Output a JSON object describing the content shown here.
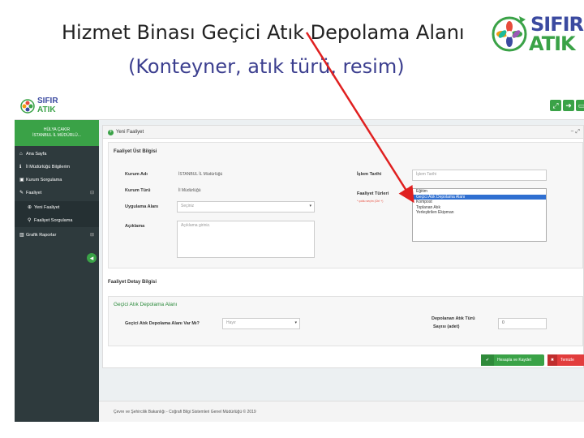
{
  "slide": {
    "title": "Hizmet Binası Geçici Atık Depolama Alanı",
    "subtitle": "(Konteyner, atık türü, resim)",
    "brand_top": "SIFIR",
    "brand_bottom": "ATIK"
  },
  "app": {
    "logo_top": "SIFIR",
    "logo_bottom": "ATIK",
    "topbar_buttons": [
      "⤢",
      "➜",
      "▭"
    ],
    "user_name": "HÜLYA ÇAKIR",
    "user_org": "İSTANBUL İL MÜDÜRLÜ...",
    "sidebar": {
      "items": [
        {
          "icon": "⌂",
          "label": "Ana Sayfa"
        },
        {
          "icon": "ℹ",
          "label": "İl Müdürlüğü Bilgilerim"
        },
        {
          "icon": "▣",
          "label": "Kurum Sorgulama"
        },
        {
          "icon": "✎",
          "label": "Faaliyet",
          "caret": "⊟"
        },
        {
          "icon": "⊕",
          "label": "Yeni Faaliyet"
        },
        {
          "icon": "⚲",
          "label": "Faaliyet Sorgulama"
        },
        {
          "icon": "▥",
          "label": "Grafik Raporlar",
          "caret": "⊞"
        }
      ],
      "collapse": "◂"
    },
    "panel": {
      "header": "Yeni Faaliyet",
      "tools": "−  ⤢",
      "ust_bilgi_title": "Faaliyet Üst Bilgisi",
      "kurum_adi_label": "Kurum Adı",
      "kurum_adi_value": "İSTANBUL İL Müdürlüğü",
      "kurum_turu_label": "Kurum Türü",
      "kurum_turu_value": "İl Müdürlüğü",
      "uygulama_alani_label": "Uygulama Alanı",
      "uygulama_alani_value": "Seçiniz",
      "aciklama_label": "Açıklama",
      "aciklama_placeholder": "Açıklama giriniz.",
      "islem_tarihi_label": "İşlem Tarihi",
      "islem_tarihi_placeholder": "İşlem Tarihi",
      "faaliyet_turleri_label": "Faaliyet Türleri",
      "faaliyet_turleri_hint": "* çoklu seçim (Ctrl +)",
      "faaliyet_turleri_options": [
        "Eğitim",
        "Geçici Atık Depolama Alanı",
        "Kompost",
        "Toplanan Atık",
        "Yerleştirilen Ekipman"
      ],
      "faaliyet_turleri_selected_index": 1,
      "detay_title": "Faaliyet Detay Bilgisi",
      "gecici_title": "Geçici Atık Depolama Alanı",
      "var_mi_label": "Geçici Atık Depolama Alanı Var Mı?",
      "var_mi_value": "Hayır",
      "depolanan_label_1": "Depolanan Atık Türü",
      "depolanan_label_2": "Sayısı (adet)",
      "depolanan_value": "0",
      "save_label": "Hesapla ve Kaydet",
      "clear_label": "Temizle",
      "save_icon": "✔",
      "clear_icon": "✖"
    },
    "footer": "Çevre ve Şehircilik Bakanlığı - Coğrafi Bilgi Sistemleri Genel Müdürlüğü © 2019"
  },
  "colors": {
    "accent_green": "#3aa247",
    "sidebar_dark": "#2e3a3d",
    "selected_blue": "#2f6fd1",
    "danger_red": "#e23d3d",
    "arrow_red": "#e02020"
  }
}
